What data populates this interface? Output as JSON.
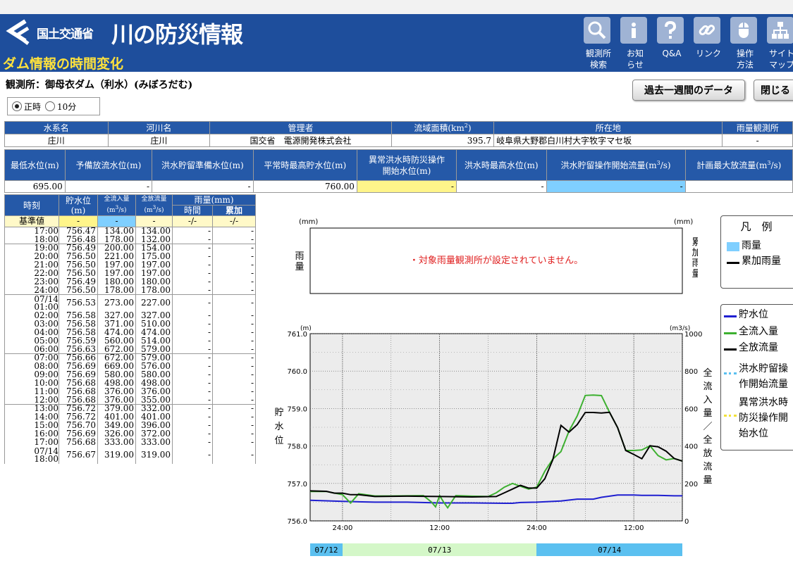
{
  "header": {
    "ministry": "国土交通省",
    "site_title": "川の防災情報",
    "page_subtitle": "ダム情報の時間変化",
    "nav": [
      {
        "icon": "magnifier-icon",
        "label": "観測所\n検索"
      },
      {
        "icon": "info-icon",
        "label": "お知\nらせ"
      },
      {
        "icon": "question-icon",
        "label": "Q&A"
      },
      {
        "icon": "link-icon",
        "label": "リンク"
      },
      {
        "icon": "mouse-icon",
        "label": "操作\n方法"
      },
      {
        "icon": "sitemap-icon",
        "label": "サイト\nマップ"
      }
    ]
  },
  "station": {
    "label": "観測所：御母衣ダム（利水）(みぼろだむ)",
    "past_week_button": "過去一週間のデータ",
    "close_button": "閉じる",
    "radio_hourly": "正時",
    "radio_10min": "10分"
  },
  "info_table": {
    "headers": [
      "水系名",
      "河川名",
      "管理者",
      "流域面積(km",
      "所在地",
      "雨量観測所"
    ],
    "area_sup": "2",
    "area_close": ")",
    "values": [
      "庄川",
      "庄川",
      "国交省　電源開発株式会社",
      "395.7",
      "岐阜県大野郡白川村大字牧字マセ坂",
      "-"
    ]
  },
  "level_table": {
    "headers": [
      "最低水位(m)",
      "予備放流水位(m)",
      "洪水貯留準備水位(m)",
      "平常時最高貯水位(m)",
      "異常洪水時防災操作\n開始水位(m)",
      "洪水時最高水位(m)",
      "洪水貯留操作開始流量(m",
      "計画最大放流量(m"
    ],
    "m3_sup": "3",
    "m3_close": "/s)",
    "values": [
      "695.00",
      "-",
      "-",
      "760.00",
      "-",
      "-",
      "-",
      ""
    ]
  },
  "data_table": {
    "headers": {
      "time": "時刻",
      "storage": "貯水位",
      "storage_unit": "(m)",
      "inflow": "全流入量",
      "outflow": "全放流量",
      "flow_unit": "(m",
      "flow_sup": "3",
      "flow_close": "/s)",
      "rain": "雨量(mm)",
      "rain_hour": "時間",
      "rain_total": "累加"
    },
    "baseline": {
      "label": "基準値",
      "storage": "-",
      "inflow": "-",
      "outflow": "-",
      "rain_hour": "-/-",
      "rain_total": "-/-"
    },
    "rows": [
      {
        "time": "17:00",
        "storage": "756.47",
        "inflow": "134.00",
        "outflow": "134.00",
        "rain_hour": "-",
        "rain_total": "-"
      },
      {
        "time": "18:00",
        "storage": "756.48",
        "inflow": "178.00",
        "outflow": "132.00",
        "rain_hour": "-",
        "rain_total": "-"
      },
      {
        "time": "19:00",
        "storage": "756.49",
        "inflow": "200.00",
        "outflow": "154.00",
        "rain_hour": "-",
        "rain_total": "-"
      },
      {
        "time": "20:00",
        "storage": "756.50",
        "inflow": "221.00",
        "outflow": "175.00",
        "rain_hour": "-",
        "rain_total": "-"
      },
      {
        "time": "21:00",
        "storage": "756.50",
        "inflow": "197.00",
        "outflow": "197.00",
        "rain_hour": "-",
        "rain_total": "-"
      },
      {
        "time": "22:00",
        "storage": "756.50",
        "inflow": "197.00",
        "outflow": "197.00",
        "rain_hour": "-",
        "rain_total": "-"
      },
      {
        "time": "23:00",
        "storage": "756.49",
        "inflow": "180.00",
        "outflow": "180.00",
        "rain_hour": "-",
        "rain_total": "-"
      },
      {
        "time": "24:00",
        "storage": "756.50",
        "inflow": "178.00",
        "outflow": "178.00",
        "rain_hour": "-",
        "rain_total": "-"
      },
      {
        "date": "07/14",
        "time": "01:00",
        "storage": "756.53",
        "inflow": "273.00",
        "outflow": "227.00",
        "rain_hour": "-",
        "rain_total": "-"
      },
      {
        "time": "02:00",
        "storage": "756.58",
        "inflow": "327.00",
        "outflow": "327.00",
        "rain_hour": "-",
        "rain_total": "-"
      },
      {
        "time": "03:00",
        "storage": "756.58",
        "inflow": "371.00",
        "outflow": "510.00",
        "rain_hour": "-",
        "rain_total": "-"
      },
      {
        "time": "04:00",
        "storage": "756.58",
        "inflow": "474.00",
        "outflow": "474.00",
        "rain_hour": "-",
        "rain_total": "-"
      },
      {
        "time": "05:00",
        "storage": "756.59",
        "inflow": "560.00",
        "outflow": "514.00",
        "rain_hour": "-",
        "rain_total": "-"
      },
      {
        "time": "06:00",
        "storage": "756.63",
        "inflow": "672.00",
        "outflow": "579.00",
        "rain_hour": "-",
        "rain_total": "-"
      },
      {
        "time": "07:00",
        "storage": "756.66",
        "inflow": "672.00",
        "outflow": "579.00",
        "rain_hour": "-",
        "rain_total": "-"
      },
      {
        "time": "08:00",
        "storage": "756.69",
        "inflow": "669.00",
        "outflow": "576.00",
        "rain_hour": "-",
        "rain_total": "-"
      },
      {
        "time": "09:00",
        "storage": "756.69",
        "inflow": "580.00",
        "outflow": "580.00",
        "rain_hour": "-",
        "rain_total": "-"
      },
      {
        "time": "10:00",
        "storage": "756.68",
        "inflow": "498.00",
        "outflow": "498.00",
        "rain_hour": "-",
        "rain_total": "-"
      },
      {
        "time": "11:00",
        "storage": "756.68",
        "inflow": "376.00",
        "outflow": "376.00",
        "rain_hour": "-",
        "rain_total": "-"
      },
      {
        "time": "12:00",
        "storage": "756.68",
        "inflow": "376.00",
        "outflow": "355.00",
        "rain_hour": "-",
        "rain_total": "-"
      },
      {
        "time": "13:00",
        "storage": "756.72",
        "inflow": "379.00",
        "outflow": "332.00",
        "rain_hour": "-",
        "rain_total": "-"
      },
      {
        "time": "14:00",
        "storage": "756.72",
        "inflow": "401.00",
        "outflow": "401.00",
        "rain_hour": "-",
        "rain_total": "-"
      },
      {
        "time": "15:00",
        "storage": "756.70",
        "inflow": "349.00",
        "outflow": "396.00",
        "rain_hour": "-",
        "rain_total": "-"
      },
      {
        "time": "16:00",
        "storage": "756.69",
        "inflow": "326.00",
        "outflow": "372.00",
        "rain_hour": "-",
        "rain_total": "-"
      },
      {
        "time": "17:00",
        "storage": "756.68",
        "inflow": "333.00",
        "outflow": "333.00",
        "rain_hour": "-",
        "rain_total": "-"
      },
      {
        "date": "07/14",
        "time": "18:00",
        "storage": "756.67",
        "inflow": "319.00",
        "outflow": "319.00",
        "rain_hour": "-",
        "rain_total": "-"
      }
    ]
  },
  "rain_chart": {
    "unit_left": "(mm)",
    "unit_right": "(mm)",
    "left_label": "雨量",
    "right_label": "累加雨量",
    "message": "・対象雨量観測所が設定されていません。"
  },
  "chart_data": {
    "type": "line",
    "x_ticks": [
      "24:00",
      "12:00",
      "24:00",
      "12:00"
    ],
    "x_tick_hours": [
      24,
      36,
      48,
      60
    ],
    "xlim_hours": [
      20,
      66
    ],
    "y_left_label": "貯水位",
    "y_left_unit": "(m)",
    "y_left_ticks": [
      "761.0",
      "760.0",
      "759.0",
      "758.0",
      "757.0",
      "756.0"
    ],
    "ylim_left": [
      756.0,
      761.0
    ],
    "y_right_label": "全流入量／全放流量",
    "y_right_unit": "(m3/s)",
    "y_right_ticks": [
      "1000",
      "800",
      "600",
      "400",
      "200",
      "0"
    ],
    "ylim_right": [
      0,
      1000
    ],
    "date_bands": [
      {
        "label": "07/12",
        "from": 20,
        "to": 24,
        "color": "#5bc0f0"
      },
      {
        "label": "07/13",
        "from": 24,
        "to": 48,
        "color": "#d4f7c8"
      },
      {
        "label": "07/14",
        "from": 48,
        "to": 66,
        "color": "#5bc0f0"
      }
    ],
    "series": [
      {
        "name": "貯水位",
        "axis": "left",
        "color": "#1f1fd0",
        "points": [
          [
            20,
            756.55
          ],
          [
            24,
            756.52
          ],
          [
            28,
            756.5
          ],
          [
            32,
            756.5
          ],
          [
            36,
            756.48
          ],
          [
            40,
            756.48
          ],
          [
            44,
            756.47
          ],
          [
            45,
            756.47
          ],
          [
            46,
            756.49
          ],
          [
            48,
            756.5
          ],
          [
            51,
            756.53
          ],
          [
            53,
            756.58
          ],
          [
            55,
            756.58
          ],
          [
            56,
            756.63
          ],
          [
            57,
            756.66
          ],
          [
            58,
            756.69
          ],
          [
            60,
            756.69
          ],
          [
            61,
            756.68
          ],
          [
            63,
            756.68
          ],
          [
            65,
            756.67
          ],
          [
            66,
            756.67
          ]
        ]
      },
      {
        "name": "全流入量",
        "axis": "right",
        "color": "#3db030",
        "points": [
          [
            20,
            157
          ],
          [
            22,
            157
          ],
          [
            24,
            140
          ],
          [
            25,
            95
          ],
          [
            26,
            145
          ],
          [
            28,
            133
          ],
          [
            30,
            133
          ],
          [
            34,
            135
          ],
          [
            35,
            100
          ],
          [
            35.5,
            75
          ],
          [
            36,
            135
          ],
          [
            36.5,
            100
          ],
          [
            37,
            70
          ],
          [
            38,
            135
          ],
          [
            40,
            132
          ],
          [
            42,
            130
          ],
          [
            43,
            150
          ],
          [
            44,
            180
          ],
          [
            45,
            200
          ],
          [
            46,
            185
          ],
          [
            47,
            170
          ],
          [
            48,
            180
          ],
          [
            49,
            265
          ],
          [
            50,
            330
          ],
          [
            51,
            370
          ],
          [
            52,
            480
          ],
          [
            53,
            560
          ],
          [
            54,
            670
          ],
          [
            55,
            672
          ],
          [
            56,
            669
          ],
          [
            57,
            580
          ],
          [
            58,
            498
          ],
          [
            59,
            376
          ],
          [
            60,
            376
          ],
          [
            61,
            379
          ],
          [
            62,
            401
          ],
          [
            63,
            349
          ],
          [
            64,
            326
          ],
          [
            65,
            333
          ],
          [
            66,
            319
          ]
        ]
      },
      {
        "name": "全放流量",
        "axis": "right",
        "color": "#000000",
        "points": [
          [
            20,
            160
          ],
          [
            22,
            158
          ],
          [
            23,
            148
          ],
          [
            24,
            148
          ],
          [
            25,
            140
          ],
          [
            26,
            140
          ],
          [
            28,
            130
          ],
          [
            32,
            132
          ],
          [
            36,
            130
          ],
          [
            40,
            128
          ],
          [
            43,
            130
          ],
          [
            44,
            150
          ],
          [
            45,
            170
          ],
          [
            46,
            190
          ],
          [
            47,
            175
          ],
          [
            48,
            175
          ],
          [
            49,
            225
          ],
          [
            50,
            327
          ],
          [
            51,
            510
          ],
          [
            52,
            474
          ],
          [
            53,
            514
          ],
          [
            54,
            579
          ],
          [
            55,
            579
          ],
          [
            56,
            576
          ],
          [
            57,
            580
          ],
          [
            58,
            498
          ],
          [
            59,
            376
          ],
          [
            60,
            355
          ],
          [
            61,
            332
          ],
          [
            62,
            401
          ],
          [
            63,
            396
          ],
          [
            64,
            372
          ],
          [
            65,
            333
          ],
          [
            66,
            319
          ]
        ]
      }
    ]
  },
  "legend_top": {
    "title": "凡　例",
    "items": [
      {
        "label": "雨量",
        "color": "#7fcfff",
        "kind": "block"
      },
      {
        "label": "累加雨量",
        "color": "#000000",
        "kind": "line"
      }
    ]
  },
  "legend_bottom": {
    "items": [
      {
        "label": "貯水位",
        "color": "#1f1fd0",
        "kind": "line"
      },
      {
        "label": "全流入量",
        "color": "#3db030",
        "kind": "line"
      },
      {
        "label": "全放流量",
        "color": "#000000",
        "kind": "line"
      },
      {
        "label": "洪水貯留操\n作開始流量",
        "color": "#5bc0f0",
        "kind": "dash"
      },
      {
        "label": "異常洪水時\n防災操作開\n始水位",
        "color": "#f2e23a",
        "kind": "dash"
      }
    ]
  }
}
